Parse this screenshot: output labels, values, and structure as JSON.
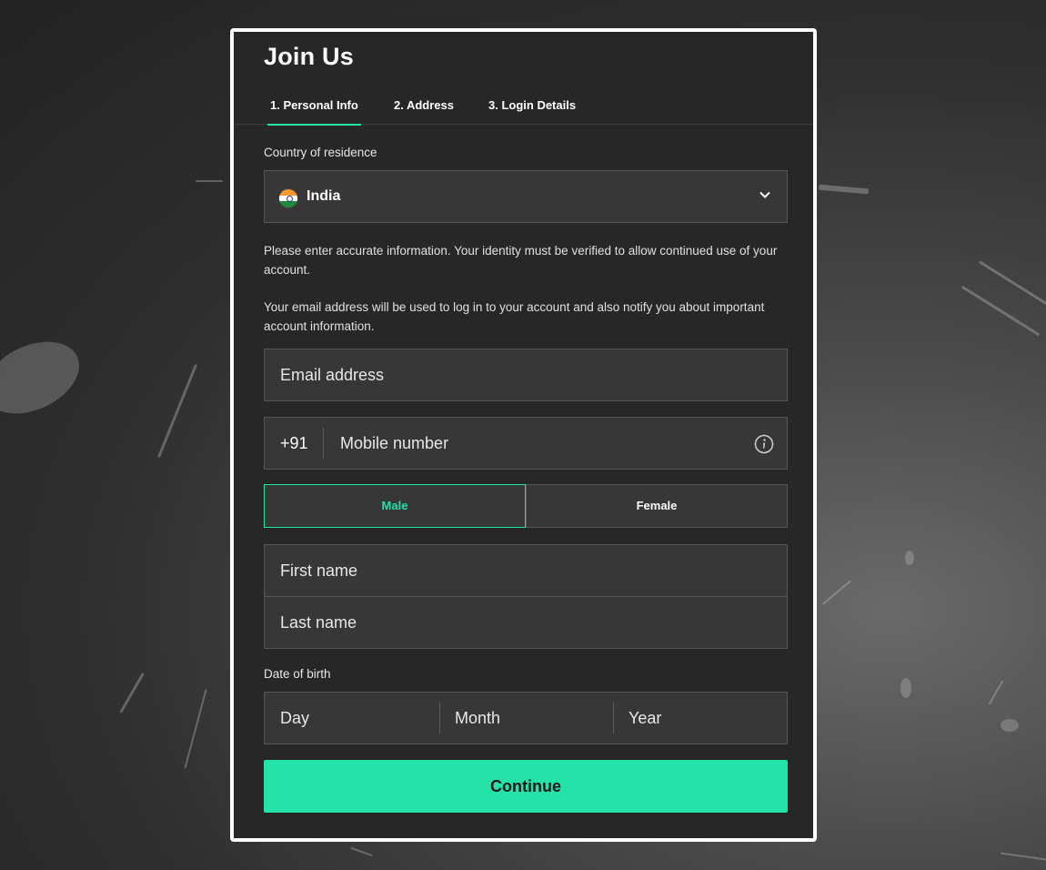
{
  "modal": {
    "title": "Join Us"
  },
  "tabs": [
    {
      "label": "1. Personal Info",
      "active": true
    },
    {
      "label": "2. Address",
      "active": false
    },
    {
      "label": "3. Login Details",
      "active": false
    }
  ],
  "country": {
    "label": "Country of residence",
    "value": "India",
    "flag_icon": "india-flag-icon"
  },
  "notices": {
    "identity": "Please enter accurate information. Your identity must be verified to allow continued use of your account.",
    "email": "Your email address will be used to log in to your account and also notify you about important account information."
  },
  "email": {
    "placeholder": "Email address"
  },
  "phone": {
    "prefix": "+91",
    "placeholder": "Mobile number"
  },
  "gender": {
    "male": "Male",
    "female": "Female",
    "selected": "Male"
  },
  "name": {
    "first_placeholder": "First name",
    "last_placeholder": "Last name"
  },
  "dob": {
    "label": "Date of birth",
    "day_placeholder": "Day",
    "month_placeholder": "Month",
    "year_placeholder": "Year"
  },
  "actions": {
    "continue_label": "Continue"
  },
  "colors": {
    "accent": "#24e2a8",
    "panel": "#272727",
    "field": "#373737"
  }
}
